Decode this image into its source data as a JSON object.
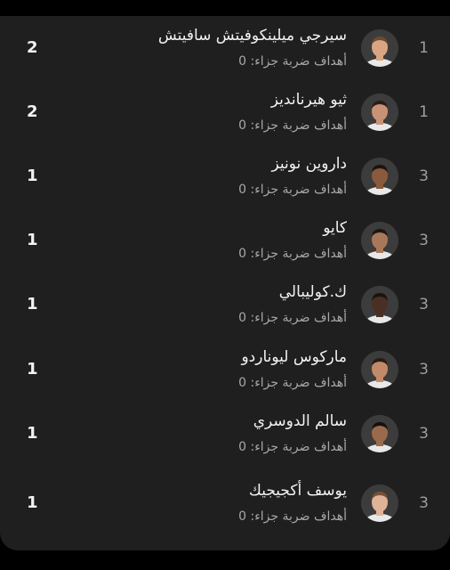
{
  "players": [
    {
      "rank": "1",
      "name": "سيرجي ميلينكوفيتش سافيتش",
      "sub": "أهداف ضربة جزاء: 0",
      "value": "2",
      "skin": "#d9a583",
      "hair": "#6b4a2f"
    },
    {
      "rank": "1",
      "name": "ثيو هيرنانديز",
      "sub": "أهداف ضربة جزاء: 0",
      "value": "2",
      "skin": "#c99276",
      "hair": "#2b1d14"
    },
    {
      "rank": "3",
      "name": "داروين نونيز",
      "sub": "أهداف ضربة جزاء: 0",
      "value": "1",
      "skin": "#8a5a3c",
      "hair": "#1a1411"
    },
    {
      "rank": "3",
      "name": "كايو",
      "sub": "أهداف ضربة جزاء: 0",
      "value": "1",
      "skin": "#a8785a",
      "hair": "#1e1612"
    },
    {
      "rank": "3",
      "name": "ك.كوليبالي",
      "sub": "أهداف ضربة جزاء: 0",
      "value": "1",
      "skin": "#4a3024",
      "hair": "#1a1210"
    },
    {
      "rank": "3",
      "name": "ماركوس ليوناردو",
      "sub": "أهداف ضربة جزاء: 0",
      "value": "1",
      "skin": "#c28a68",
      "hair": "#2a1c14"
    },
    {
      "rank": "3",
      "name": "سالم الدوسري",
      "sub": "أهداف ضربة جزاء: 0",
      "value": "1",
      "skin": "#9a6a4c",
      "hair": "#151010"
    },
    {
      "rank": "3",
      "name": "يوسف أكجيجيك",
      "sub": "أهداف ضربة جزاء: 0",
      "value": "1",
      "skin": "#e0b398",
      "hair": "#7a5034"
    }
  ]
}
